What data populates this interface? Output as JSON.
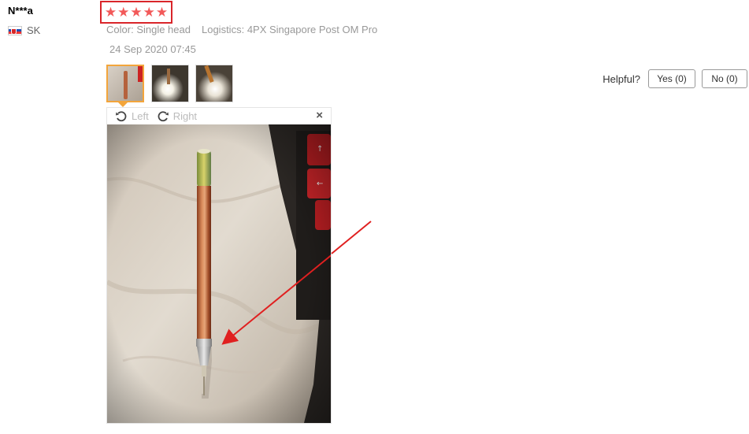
{
  "reviewer": {
    "name": "N***a",
    "country_code": "SK",
    "flag_icon": "slovakia-flag-icon"
  },
  "rating": {
    "stars": 5,
    "max": 5,
    "star_glyph": "★",
    "color": "#f25959",
    "highlight_color": "#d9252a"
  },
  "meta": {
    "color_label": "Color:",
    "color_value": "Single head",
    "logistics_label": "Logistics:",
    "logistics_value": "4PX Singapore Post OM Pro"
  },
  "date": "24 Sep 2020 07:45",
  "thumbnails": [
    {
      "name": "photo-1",
      "active": true
    },
    {
      "name": "photo-2",
      "active": false
    },
    {
      "name": "photo-3",
      "active": false
    }
  ],
  "viewer": {
    "rotate_left_label": "Left",
    "rotate_right_label": "Right",
    "close_glyph": "×",
    "annotation_arrow_color": "#e02020"
  },
  "helpful": {
    "label": "Helpful?",
    "yes_label": "Yes (0)",
    "no_label": "No (0)"
  }
}
